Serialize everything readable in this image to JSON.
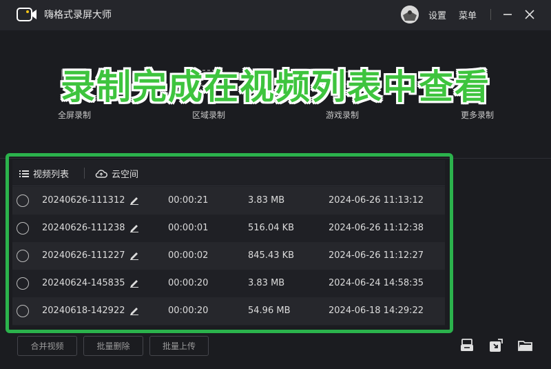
{
  "app": {
    "title": "嗨格式录屏大师",
    "settings_label": "设置",
    "menu_label": "菜单"
  },
  "modes": [
    {
      "label": "全屏录制"
    },
    {
      "label": "区域录制"
    },
    {
      "label": "游戏录制"
    },
    {
      "label": "更多录制"
    }
  ],
  "banner": "录制完成在视频列表中查看",
  "tabs": {
    "video_list": "视频列表",
    "cloud": "云空间"
  },
  "videos": [
    {
      "name": "20240626-111312",
      "duration": "00:00:21",
      "size": "3.83 MB",
      "date": "2024-06-26 11:13:12"
    },
    {
      "name": "20240626-111238",
      "duration": "00:00:01",
      "size": "516.04 KB",
      "date": "2024-06-26 11:12:38"
    },
    {
      "name": "20240626-111227",
      "duration": "00:00:02",
      "size": "845.43 KB",
      "date": "2024-06-26 11:12:27"
    },
    {
      "name": "20240624-145835",
      "duration": "00:00:20",
      "size": "3.83 MB",
      "date": "2024-06-24 14:58:35"
    },
    {
      "name": "20240618-142922",
      "duration": "00:00:20",
      "size": "54.96 MB",
      "date": "2024-06-18 14:29:22"
    }
  ],
  "actions": {
    "merge": "合并视频",
    "batch_delete": "批量删除",
    "batch_upload": "批量上传"
  },
  "colors": {
    "highlight": "#2bb24c",
    "banner_text": "#3ec43e",
    "background": "#1b1c20"
  }
}
